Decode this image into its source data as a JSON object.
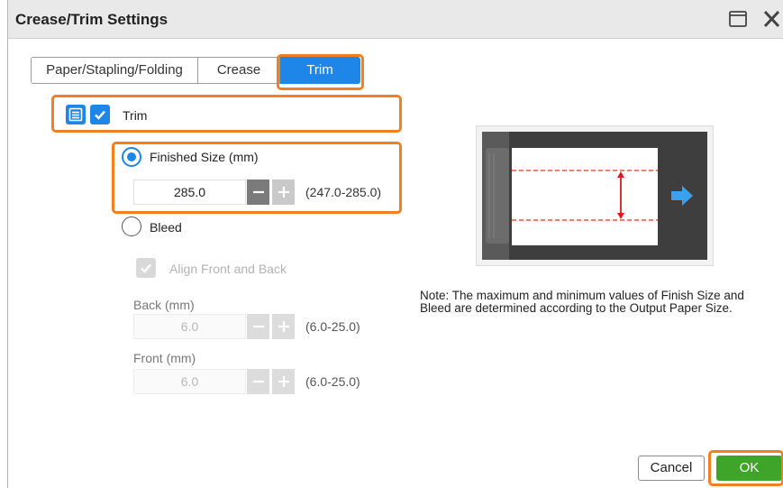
{
  "dialog": {
    "title": "Crease/Trim Settings",
    "maximize_icon": "window-icon",
    "close_icon": "close-icon"
  },
  "tabs": [
    {
      "label": "Paper/Stapling/Folding",
      "active": false
    },
    {
      "label": "Crease",
      "active": false
    },
    {
      "label": "Trim",
      "active": true
    }
  ],
  "trim": {
    "label": "Trim",
    "checked": true,
    "icon": "trim-layout-icon"
  },
  "finished_size": {
    "label": "Finished Size (mm)",
    "selected": true,
    "value": "285.0",
    "range": "(247.0-285.0)"
  },
  "bleed": {
    "label": "Bleed",
    "selected": false,
    "align_label": "Align Front and Back",
    "align_checked": true,
    "back": {
      "label": "Back (mm)",
      "value": "6.0",
      "range": "(6.0-25.0)"
    },
    "front": {
      "label": "Front (mm)",
      "value": "6.0",
      "range": "(6.0-25.0)"
    }
  },
  "note": "Note: The maximum and minimum values of Finish Size and Bleed are determined according to the Output Paper Size.",
  "buttons": {
    "cancel": "Cancel",
    "ok": "OK"
  },
  "colors": {
    "accent": "#1d86e8",
    "highlight": "#f28020",
    "ok": "#3fa52a",
    "guide": "#e0301e"
  }
}
